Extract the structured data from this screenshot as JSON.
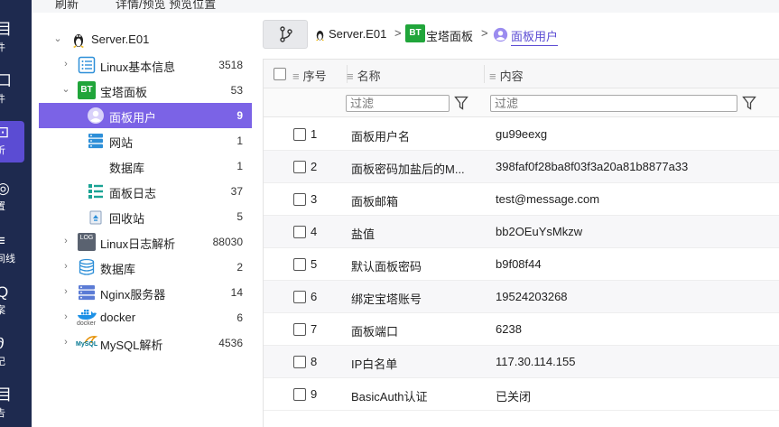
{
  "toolbar": {
    "item1": "刷新",
    "item2": "详情/预览 预览位置"
  },
  "rail": [
    {
      "glyph": "目",
      "label": "件"
    },
    {
      "glyph": "口",
      "label": "件"
    },
    {
      "glyph": "⊡",
      "label": "析"
    },
    {
      "glyph": "◎",
      "label": "置"
    },
    {
      "glyph": "≡",
      "label": "间线"
    },
    {
      "glyph": "Q",
      "label": "案"
    },
    {
      "glyph": "∂",
      "label": "记"
    },
    {
      "glyph": "目",
      "label": "告"
    }
  ],
  "tree": {
    "root": "Server.E01",
    "items": [
      {
        "label": "Linux基本信息",
        "count": "3518"
      },
      {
        "label": "宝塔面板",
        "count": "53"
      },
      {
        "label": "面板用户",
        "count": "9"
      },
      {
        "label": "网站",
        "count": "1"
      },
      {
        "label": "数据库",
        "count": "1"
      },
      {
        "label": "面板日志",
        "count": "37"
      },
      {
        "label": "回收站",
        "count": "5"
      },
      {
        "label": "Linux日志解析",
        "count": "88030"
      },
      {
        "label": "数据库",
        "count": "2"
      },
      {
        "label": "Nginx服务器",
        "count": "14"
      },
      {
        "label": "docker",
        "count": "6"
      },
      {
        "label": "MySQL解析",
        "count": "4536"
      }
    ],
    "icon_texts": {
      "bt": "BT",
      "log": "LOG",
      "docker": "docker",
      "mysql": "MySQL"
    }
  },
  "breadcrumb": {
    "server": "Server.E01",
    "panel": "宝塔面板",
    "current": "面板用户",
    "sep": ">"
  },
  "grid": {
    "columns": {
      "seq": "序号",
      "name": "名称",
      "content": "内容"
    },
    "filter_placeholder": "过滤",
    "rows": [
      {
        "seq": "1",
        "name": "面板用户名",
        "content": "gu99eexg"
      },
      {
        "seq": "2",
        "name": "面板密码加盐后的M...",
        "content": "398faf0f28ba8f03f3a20a81b8877a33"
      },
      {
        "seq": "3",
        "name": "面板邮箱",
        "content": "test@message.com"
      },
      {
        "seq": "4",
        "name": "盐值",
        "content": "bb2OEuYsMkzw"
      },
      {
        "seq": "5",
        "name": "默认面板密码",
        "content": "b9f08f44"
      },
      {
        "seq": "6",
        "name": "绑定宝塔账号",
        "content": "19524203268"
      },
      {
        "seq": "7",
        "name": "面板端口",
        "content": "6238"
      },
      {
        "seq": "8",
        "name": "IP白名单",
        "content": "117.30.114.155"
      },
      {
        "seq": "9",
        "name": "BasicAuth认证",
        "content": "已关闭"
      }
    ]
  },
  "colors": {
    "rail": "#1e2a4f",
    "rail_active": "#5b4cd3",
    "selected_row": "#7b63e6",
    "accent": "#5b4cd3"
  }
}
